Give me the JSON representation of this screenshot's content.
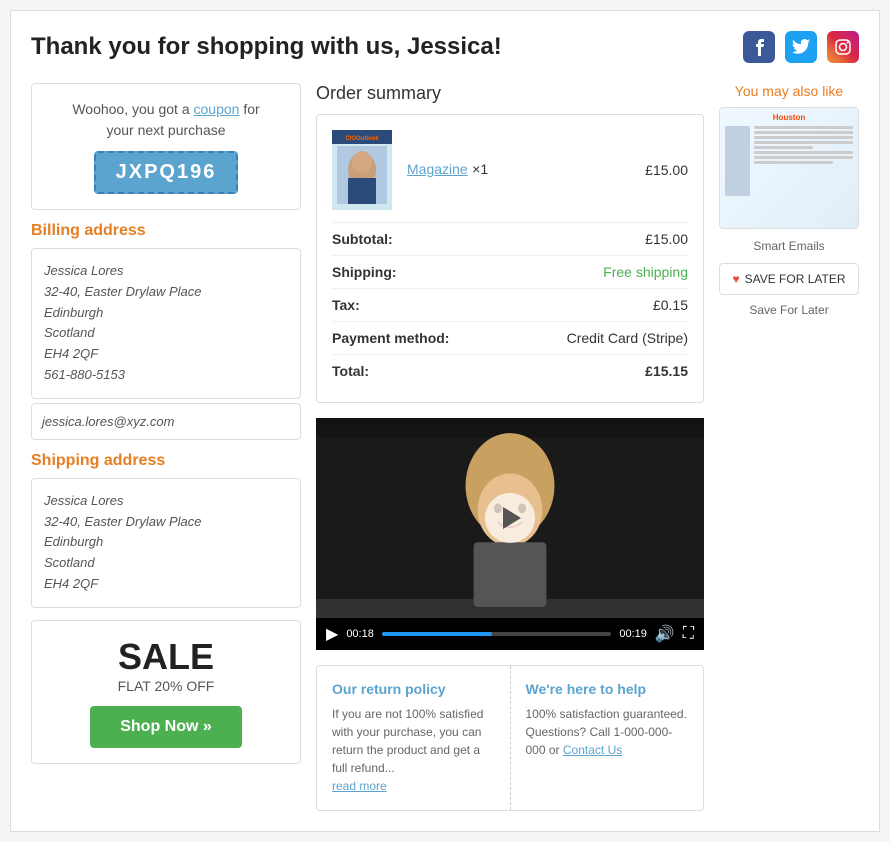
{
  "header": {
    "title": "Thank you for shopping with us, Jessica!",
    "social": {
      "facebook_label": "f",
      "twitter_label": "t",
      "instagram_label": "ig"
    }
  },
  "coupon": {
    "text_line1": "Woohoo, you got a",
    "text_link": "coupon",
    "text_line2": "for",
    "text_line3": "your next purchase",
    "code": "JXPQ196"
  },
  "billing": {
    "title": "Billing address",
    "name": "Jessica Lores",
    "address1": "32-40, Easter Drylaw Place",
    "city": "Edinburgh",
    "region": "Scotland",
    "postcode": "EH4 2QF",
    "phone": "561-880-5153",
    "email": "jessica.lores@xyz.com"
  },
  "shipping": {
    "title": "Shipping address",
    "name": "Jessica Lores",
    "address1": "32-40, Easter Drylaw Place",
    "city": "Edinburgh",
    "region": "Scotland",
    "postcode": "EH4 2QF"
  },
  "sale": {
    "title": "SALE",
    "subtitle": "FLAT 20% OFF",
    "button": "Shop Now »"
  },
  "order_summary": {
    "title": "Order summary",
    "product_name": "Magazine",
    "product_qty": "×1",
    "product_price": "£15.00",
    "subtotal_label": "Subtotal:",
    "subtotal_value": "£15.00",
    "shipping_label": "Shipping:",
    "shipping_value": "Free shipping",
    "tax_label": "Tax:",
    "tax_value": "£0.15",
    "payment_label": "Payment method:",
    "payment_value": "Credit Card (Stripe)",
    "total_label": "Total:",
    "total_value": "£15.15"
  },
  "video": {
    "play_label": "▶",
    "time_current": "00:18",
    "time_total": "00:19"
  },
  "return_policy": {
    "title": "Our return policy",
    "text": "If you are not 100% satisfied with your purchase, you can return the product and get a full refund...",
    "read_more": "read more"
  },
  "help": {
    "title": "We're here to help",
    "text": "100% satisfaction guaranteed. Questions? Call 1-000-000-000 or",
    "link": "Contact Us"
  },
  "sidebar": {
    "title": "You may also like",
    "product_label": "Smart Emails",
    "save_btn": "SAVE FOR LATER",
    "save_label": "Save For Later"
  }
}
